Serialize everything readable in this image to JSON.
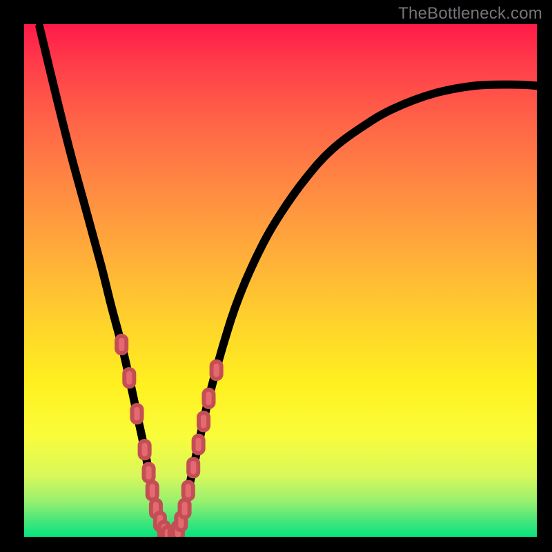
{
  "watermark": {
    "text": "TheBottleneck.com"
  },
  "chart_data": {
    "type": "line",
    "title": "",
    "xlabel": "",
    "ylabel": "",
    "xlim": [
      0,
      100
    ],
    "ylim": [
      0,
      100
    ],
    "grid": false,
    "background_gradient": {
      "stops": [
        {
          "pos": 0.0,
          "color": "#ff1a49"
        },
        {
          "pos": 0.2,
          "color": "#ff6747"
        },
        {
          "pos": 0.44,
          "color": "#ffab3a"
        },
        {
          "pos": 0.7,
          "color": "#fff01f"
        },
        {
          "pos": 0.88,
          "color": "#d9f85a"
        },
        {
          "pos": 1.0,
          "color": "#06e37e"
        }
      ]
    },
    "series": [
      {
        "name": "curve",
        "x": [
          3.0,
          6.0,
          9.0,
          12.0,
          15.0,
          17.0,
          19.0,
          20.5,
          22.0,
          23.5,
          25.0,
          26.5,
          28.0,
          29.3,
          30.6,
          32.0,
          34.0,
          36.0,
          39.0,
          42.0,
          46.0,
          50.0,
          55.0,
          60.0,
          66.0,
          72.0,
          80.0,
          88.0,
          96.0,
          100.0
        ],
        "y": [
          99.5,
          87.0,
          75.0,
          64.0,
          53.0,
          45.0,
          37.5,
          31.0,
          24.0,
          17.0,
          9.0,
          3.0,
          0.2,
          0.2,
          3.0,
          9.0,
          18.0,
          27.0,
          38.0,
          47.0,
          56.0,
          63.0,
          70.0,
          75.5,
          80.0,
          83.5,
          86.5,
          88.0,
          88.2,
          88.0
        ]
      }
    ],
    "markers": {
      "name": "markers",
      "shape": "rounded-rect",
      "color": "#e46a6f",
      "points": [
        {
          "x": 19.0,
          "y": 37.5
        },
        {
          "x": 20.5,
          "y": 31.0
        },
        {
          "x": 22.0,
          "y": 24.0
        },
        {
          "x": 23.5,
          "y": 17.0
        },
        {
          "x": 24.3,
          "y": 12.5
        },
        {
          "x": 25.0,
          "y": 9.0
        },
        {
          "x": 25.7,
          "y": 5.5
        },
        {
          "x": 26.5,
          "y": 3.0
        },
        {
          "x": 27.3,
          "y": 1.2
        },
        {
          "x": 28.0,
          "y": 0.2
        },
        {
          "x": 29.3,
          "y": 0.2
        },
        {
          "x": 30.0,
          "y": 1.2
        },
        {
          "x": 30.6,
          "y": 3.0
        },
        {
          "x": 31.3,
          "y": 5.5
        },
        {
          "x": 32.0,
          "y": 9.0
        },
        {
          "x": 33.0,
          "y": 13.5
        },
        {
          "x": 34.0,
          "y": 18.0
        },
        {
          "x": 35.0,
          "y": 22.5
        },
        {
          "x": 36.0,
          "y": 27.0
        },
        {
          "x": 37.5,
          "y": 32.5
        }
      ]
    }
  }
}
